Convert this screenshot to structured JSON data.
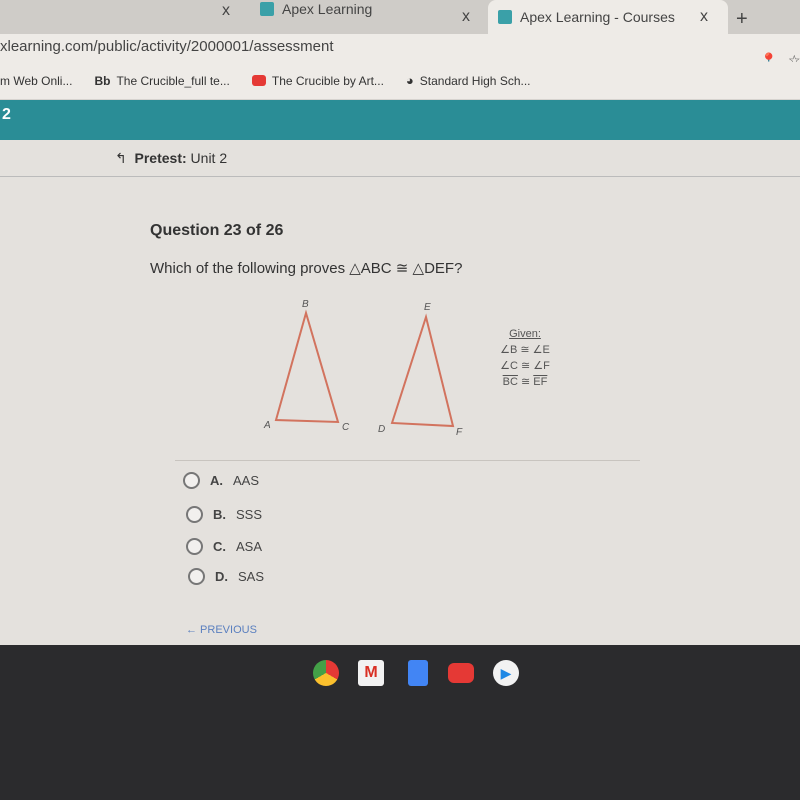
{
  "browser": {
    "tabs": [
      {
        "label": ""
      },
      {
        "label": "Apex Learning"
      },
      {
        "label": "Apex Learning - Courses"
      }
    ],
    "new_tab": "+",
    "close": "x",
    "url": "xlearning.com/public/activity/2000001/assessment",
    "bookmarks": [
      {
        "label": "m Web Onli..."
      },
      {
        "label": "The Crucible_full te...",
        "prefix": "Bb"
      },
      {
        "label": "The Crucible by Art..."
      },
      {
        "label": "Standard High Sch..."
      }
    ]
  },
  "header": {
    "unit_number": "2"
  },
  "breadcrumb": {
    "label": "Pretest:",
    "value": "Unit 2"
  },
  "question": {
    "number": "Question 23 of 26",
    "text": "Which of the following proves △ABC ≅ △DEF?",
    "diagram": {
      "labels": [
        "A",
        "B",
        "C",
        "D",
        "E",
        "F"
      ],
      "given_title": "Given:",
      "given": [
        "∠B ≅ ∠E",
        "∠C ≅ ∠F"
      ],
      "given_segment": {
        "left": "BC",
        "rel": "≅",
        "right": "EF"
      },
      "color": "#d2735e"
    },
    "options": [
      {
        "letter": "A.",
        "text": "AAS"
      },
      {
        "letter": "B.",
        "text": "SSS"
      },
      {
        "letter": "C.",
        "text": "ASA"
      },
      {
        "letter": "D.",
        "text": "SAS"
      }
    ]
  },
  "nav": {
    "previous": "← PREVIOUS"
  },
  "shelf": {
    "apps": [
      "chrome-icon",
      "gmail-icon",
      "docs-icon",
      "youtube-icon",
      "play-store-icon"
    ]
  },
  "colors": {
    "teal": "#2a8d96",
    "link": "#5a7fbf"
  }
}
